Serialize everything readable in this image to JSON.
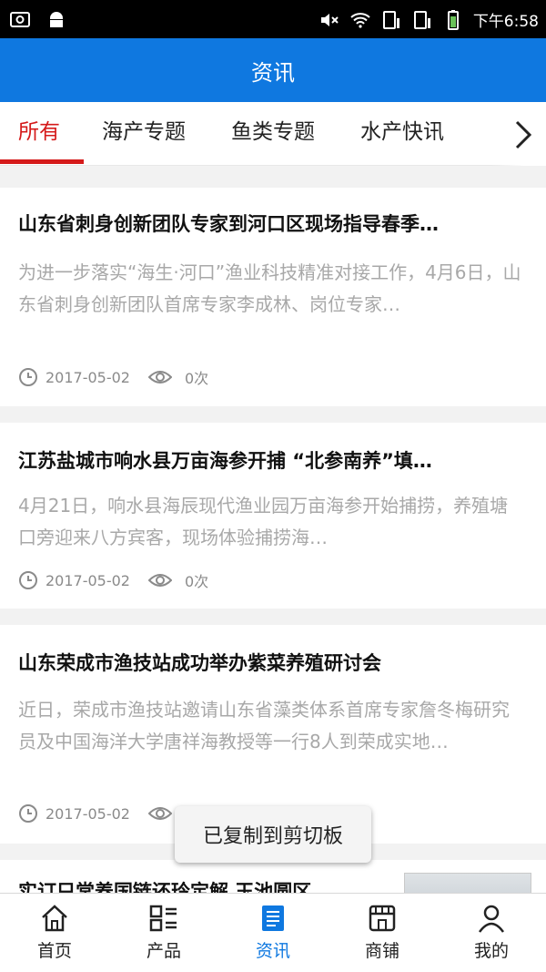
{
  "statusbar": {
    "time": "下午6:58"
  },
  "header": {
    "title": "资讯"
  },
  "tabs": [
    {
      "label": "所有",
      "active": true
    },
    {
      "label": "海产专题"
    },
    {
      "label": "鱼类专题"
    },
    {
      "label": "水产快讯"
    }
  ],
  "articles": [
    {
      "title": "山东省刺身创新团队专家到河口区现场指导春季…",
      "summary": "为进一步落实“海生·河口”渔业科技精准对接工作，4月6日，山东省刺身创新团队首席专家李成林、岗位专家…",
      "date": "2017-05-02",
      "views": "0次"
    },
    {
      "title": "江苏盐城市响水县万亩海参开捕 “北参南养”填…",
      "summary": " 4月21日，响水县海辰现代渔业园万亩海参开始捕捞，养殖塘口旁迎来八方宾客，现场体验捕捞海…",
      "date": "2017-05-02",
      "views": "0次"
    },
    {
      "title": "山东荣成市渔技站成功举办紫菜养殖研讨会",
      "summary": "近日，荣成市渔技站邀请山东省藻类体系首席专家詹冬梅研究员及中国海洋大学唐祥海教授等一行8人到荣成实地…",
      "date": "2017-05-02",
      "views": ""
    }
  ],
  "partial_article": {
    "title": "实订只常养国链还玲定解 玉池圆区"
  },
  "toast": "已复制到剪切板",
  "bottom_nav": [
    {
      "label": "首页",
      "icon": "home-icon"
    },
    {
      "label": "产品",
      "icon": "grid-list-icon"
    },
    {
      "label": "资讯",
      "icon": "news-icon",
      "active": true
    },
    {
      "label": "商铺",
      "icon": "shop-icon"
    },
    {
      "label": "我的",
      "icon": "user-icon"
    }
  ],
  "colors": {
    "accent": "#0f78e0",
    "tab_active": "#d51a1a"
  }
}
